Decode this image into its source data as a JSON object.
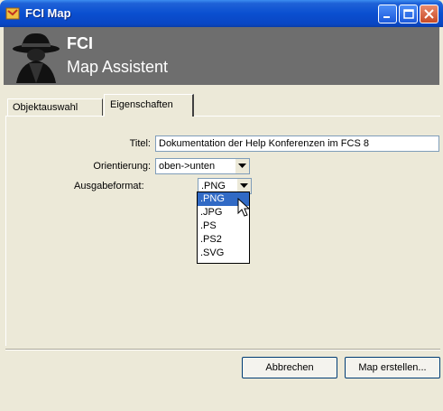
{
  "window": {
    "title": "FCI Map"
  },
  "banner": {
    "title": "FCI",
    "subtitle": "Map Assistent"
  },
  "tabs": [
    {
      "label": "Objektauswahl",
      "active": false
    },
    {
      "label": "Eigenschaften",
      "active": true
    }
  ],
  "form": {
    "title_label": "Titel:",
    "title_value": "Dokumentation der Help Konferenzen im FCS 8",
    "orientation_label": "Orientierung:",
    "orientation_value": "oben->unten",
    "format_label": "Ausgabeformat:",
    "format_value": ".PNG",
    "format_options": [
      ".PNG",
      ".JPG",
      ".PS",
      ".PS2",
      ".SVG"
    ],
    "format_highlighted": ".PNG"
  },
  "buttons": {
    "cancel": "Abbrechen",
    "create": "Map erstellen..."
  },
  "colors": {
    "titlebar": "#0a4fd0",
    "banner": "#6e6e6e",
    "selection": "#316ac5",
    "window_bg": "#ece9d8"
  },
  "icons": {
    "app": "map-app-icon",
    "logo": "spy-hat-icon"
  }
}
